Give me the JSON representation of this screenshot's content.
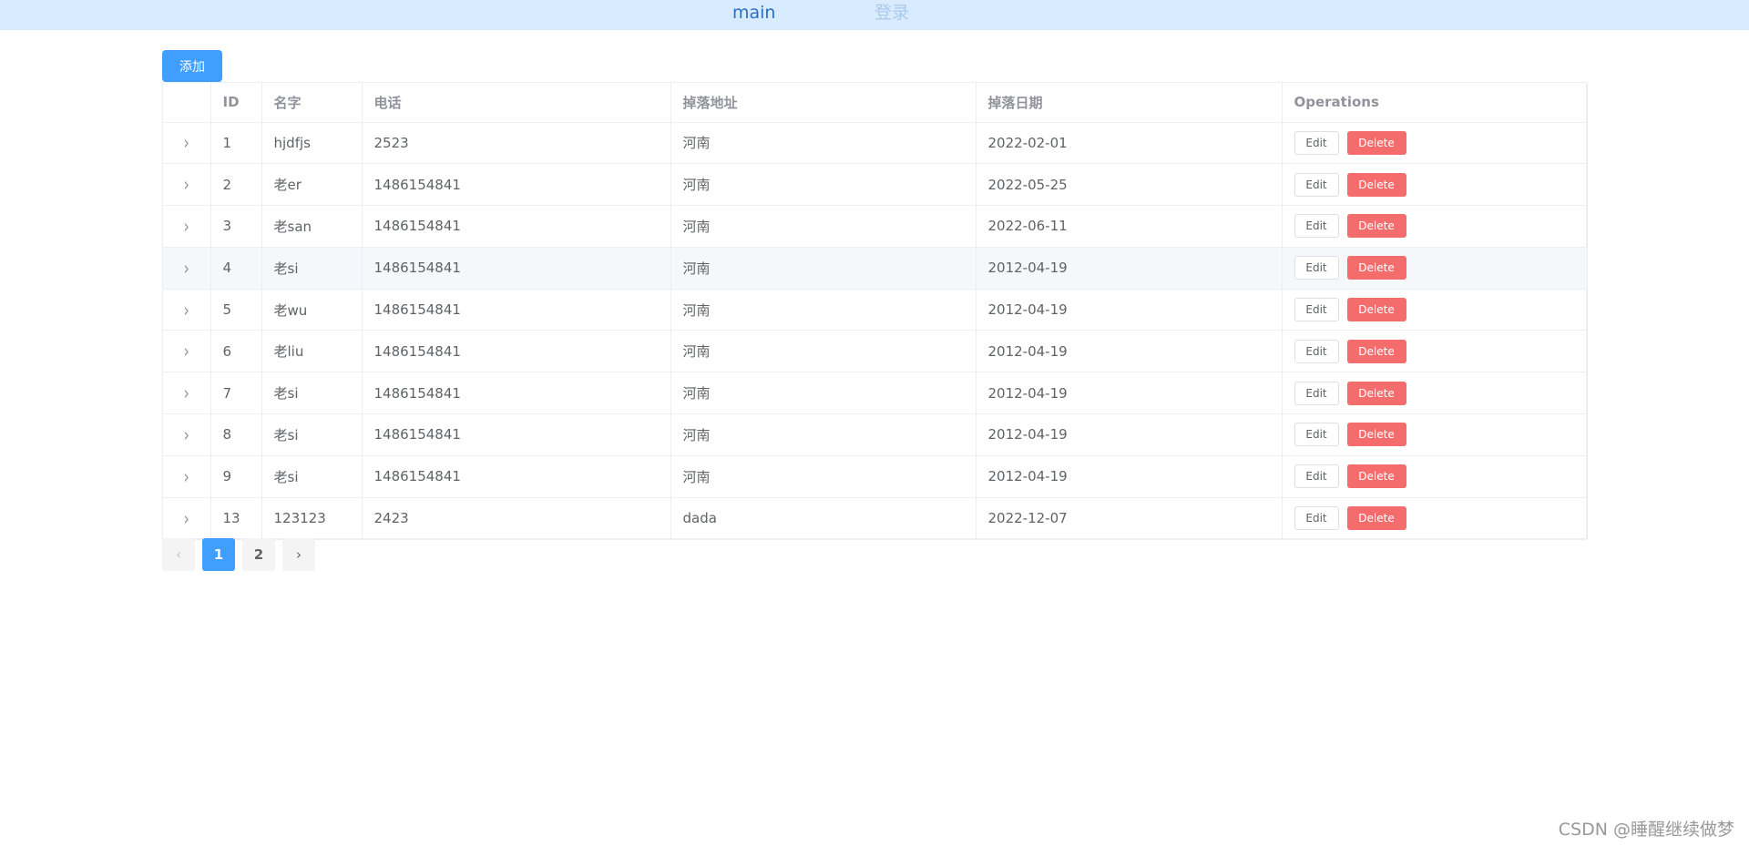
{
  "nav": {
    "main": "main",
    "login": "登录"
  },
  "toolbar": {
    "add_label": "添加"
  },
  "table": {
    "headers": [
      "ID",
      "名字",
      "电话",
      "掉落地址",
      "掉落日期",
      "Operations"
    ],
    "edit_label": "Edit",
    "delete_label": "Delete",
    "expand_glyph": "›",
    "rows": [
      [
        "1",
        "hjdfjs",
        "2523",
        "河南",
        "2022-02-01"
      ],
      [
        "2",
        "老er",
        "1486154841",
        "河南",
        "2022-05-25"
      ],
      [
        "3",
        "老san",
        "1486154841",
        "河南",
        "2022-06-11"
      ],
      [
        "4",
        "老si",
        "1486154841",
        "河南",
        "2012-04-19"
      ],
      [
        "5",
        "老wu",
        "1486154841",
        "河南",
        "2012-04-19"
      ],
      [
        "6",
        "老liu",
        "1486154841",
        "河南",
        "2012-04-19"
      ],
      [
        "7",
        "老si",
        "1486154841",
        "河南",
        "2012-04-19"
      ],
      [
        "8",
        "老si",
        "1486154841",
        "河南",
        "2012-04-19"
      ],
      [
        "9",
        "老si",
        "1486154841",
        "河南",
        "2012-04-19"
      ],
      [
        "13",
        "123123",
        "2423",
        "dada",
        "2022-12-07"
      ]
    ],
    "hovered_row_index": 3
  },
  "pagination": {
    "prev": "‹",
    "pages": [
      "1",
      "2"
    ],
    "current": "1",
    "next": "›"
  },
  "watermark": "CSDN @睡醒继续做梦",
  "colors": {
    "primary": "#409eff",
    "danger": "#f56c6c",
    "nav_bg": "#d9ebff"
  }
}
